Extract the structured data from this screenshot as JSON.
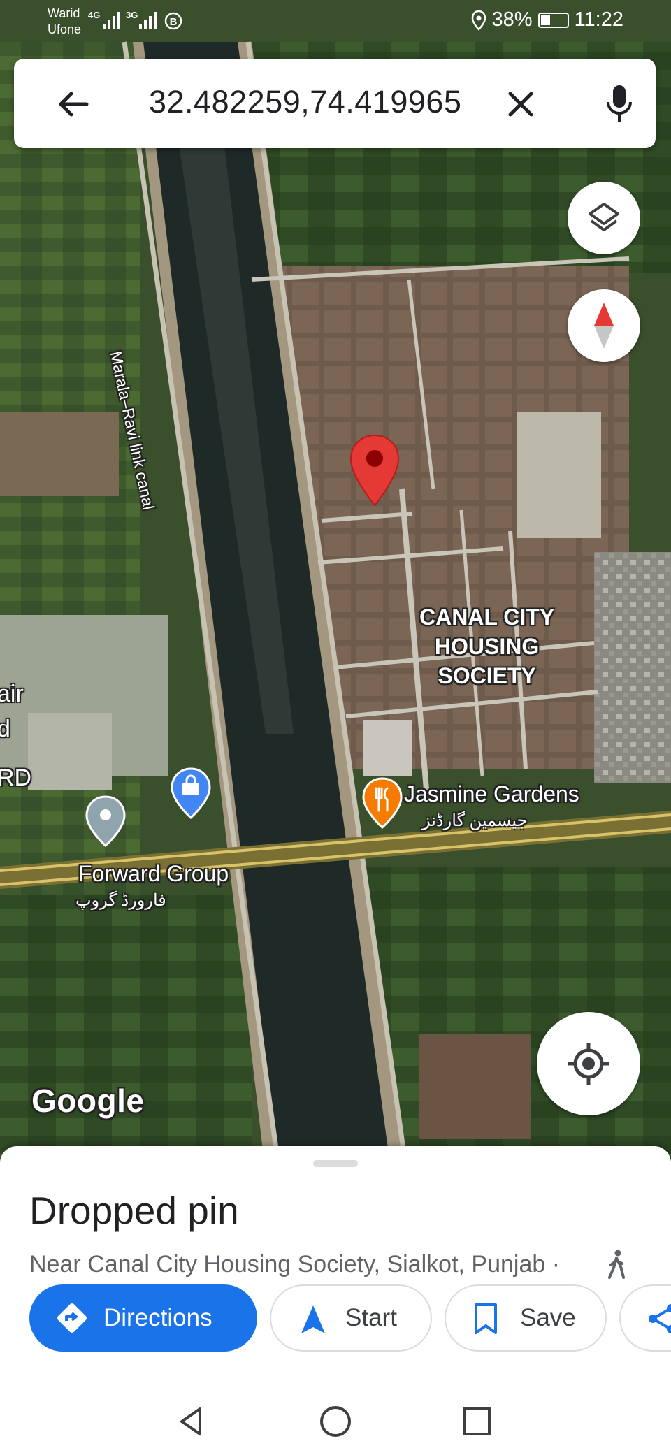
{
  "status_bar": {
    "carrier_1": "Warid",
    "carrier_2": "Ufone",
    "network_1": "4G",
    "network_2": "3G",
    "battery_percent": "38%",
    "battery_level": 0.38,
    "time": "11:22",
    "icons": [
      "location-icon",
      "battery-icon",
      "signal-icon",
      "b-circle-icon"
    ]
  },
  "search": {
    "query": "32.482259,74.419965",
    "icons": [
      "back-arrow-icon",
      "close-icon",
      "mic-icon"
    ]
  },
  "map": {
    "labels": {
      "canal": "Marala–Ravi link canal",
      "society_lines": [
        "CANAL CITY",
        "HOUSING",
        "SOCIETY"
      ],
      "jasmine": "Jasmine Gardens",
      "jasmine_urdu": "جیسمین گارڈنز",
      "forward": "Forward Group",
      "forward_urdu": "فارورڈ گروپ",
      "partial_1": "air",
      "partial_2": "d",
      "partial_3": "RD"
    },
    "logo": "Google",
    "colors": {
      "pin": "#e53935",
      "pin_dot": "#8b0000",
      "restaurant_poi": "#f57c00",
      "shopping_poi": "#4285f4",
      "generic_poi": "#90a4ae"
    },
    "controls": [
      "layers-icon",
      "compass-icon",
      "my-location-icon"
    ]
  },
  "place": {
    "title": "Dropped pin",
    "address": "Near Canal City Housing Society, Sialkot, Punjab ·",
    "actions": {
      "directions": "Directions",
      "start": "Start",
      "save": "Save"
    },
    "accent": "#1a73e8"
  },
  "nav": {
    "icons": [
      "nav-back-icon",
      "nav-home-icon",
      "nav-recents-icon"
    ]
  }
}
